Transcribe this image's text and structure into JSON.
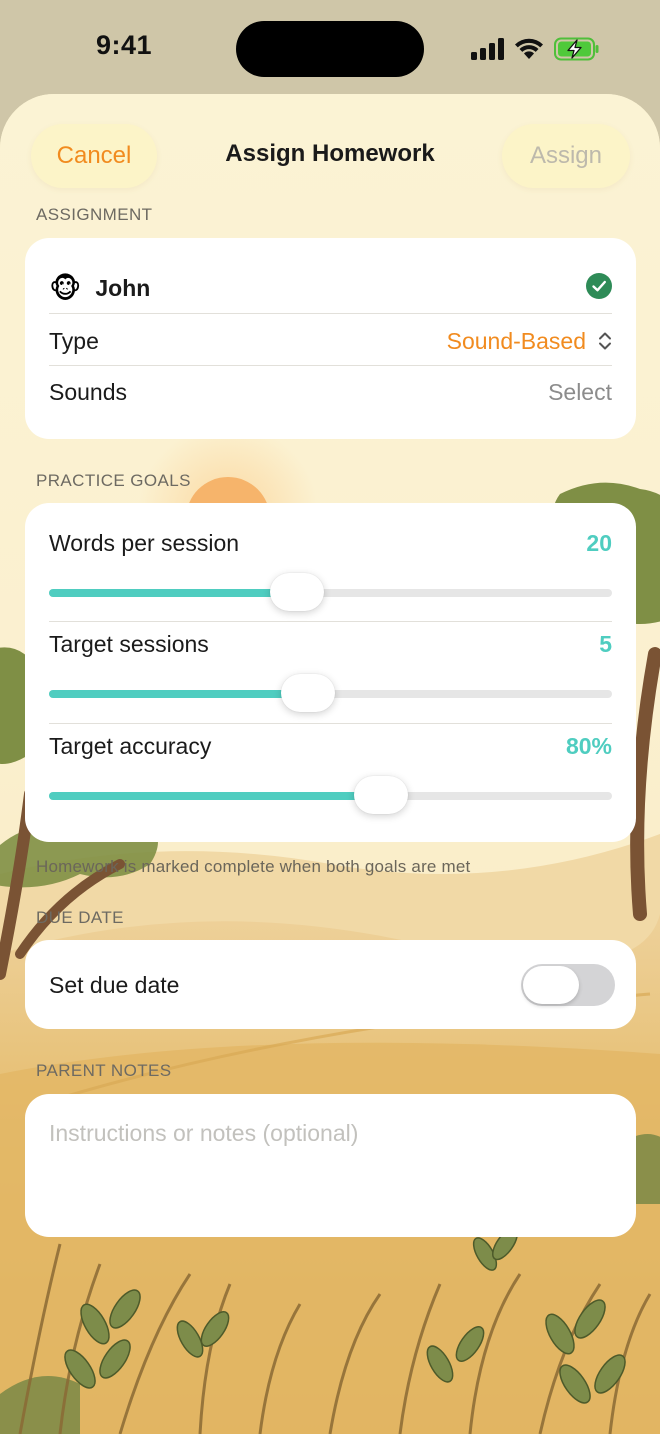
{
  "status_bar": {
    "time": "9:41",
    "icons": [
      "signal-icon",
      "wifi-icon",
      "battery-charging-icon"
    ]
  },
  "nav": {
    "cancel_label": "Cancel",
    "title": "Assign Homework",
    "assign_label": "Assign"
  },
  "assignment": {
    "header": "Assignment",
    "child_emoji": "🐵",
    "child_name": "John",
    "type_label": "Type",
    "type_value": "Sound-Based",
    "sounds_label": "Sounds",
    "sounds_value": "Select"
  },
  "practice_goals": {
    "header": "Practice Goals",
    "sliders": [
      {
        "label": "Words per session",
        "value": "20",
        "level": 0.44
      },
      {
        "label": "Target sessions",
        "value": "5",
        "level": 0.46
      },
      {
        "label": "Target accuracy",
        "value": "80%",
        "level": 0.59
      }
    ],
    "footer": "Homework is marked complete when both goals are met"
  },
  "due_date": {
    "header": "Due Date",
    "label": "Set due date",
    "enabled": false
  },
  "parent_notes": {
    "header": "Parent Notes",
    "placeholder": "Instructions or notes (optional)"
  },
  "colors": {
    "accent_orange": "#f18b1f",
    "teal": "#4fcdc0",
    "check_green": "#2e8b57"
  }
}
